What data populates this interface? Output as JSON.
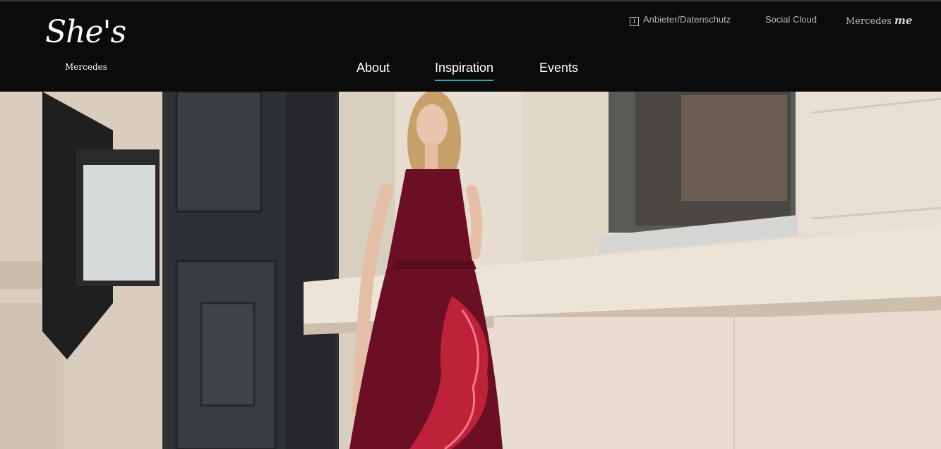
{
  "header": {
    "logo": {
      "script": "She's",
      "sub": "Mercedes"
    },
    "utility": {
      "imprint_label": "Anbieter/Datenschutz",
      "imprint_icon": "info-icon",
      "social_label": "Social Cloud",
      "mercedes_label": "Mercedes",
      "mercedes_me": "me"
    },
    "nav": {
      "items": [
        {
          "label": "About"
        },
        {
          "label": "Inspiration",
          "active": true
        },
        {
          "label": "Events"
        }
      ],
      "active_color": "#2fb3a9"
    }
  },
  "hero": {
    "image": "woman in burgundy dress walking past stone building"
  }
}
